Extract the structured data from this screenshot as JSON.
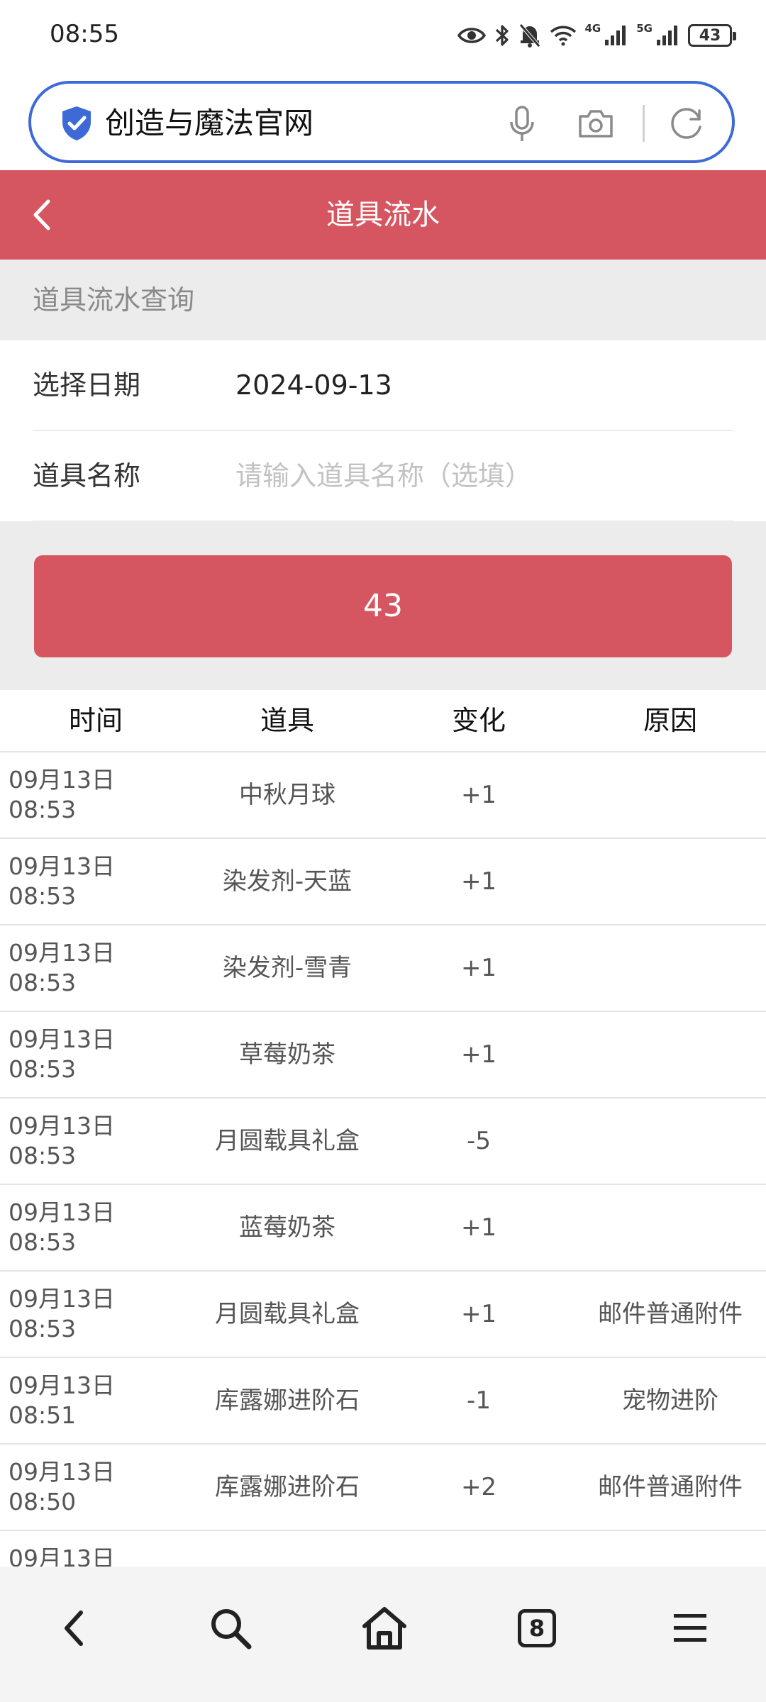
{
  "status_bar": {
    "time": "08:55",
    "net1": "4G",
    "net2": "5G",
    "battery": "43"
  },
  "address_bar": {
    "title": "创造与魔法官网"
  },
  "header": {
    "title": "道具流水"
  },
  "query": {
    "section_title": "道具流水查询",
    "date_label": "选择日期",
    "date_value": "2024-09-13",
    "item_label": "道具名称",
    "item_placeholder": "请输入道具名称（选填）",
    "button_label": "43"
  },
  "table": {
    "headers": [
      "时间",
      "道具",
      "变化",
      "原因"
    ],
    "rows": [
      {
        "date": "09月13日",
        "time": "08:53",
        "item": "中秋月球",
        "change": "+1",
        "reason": ""
      },
      {
        "date": "09月13日",
        "time": "08:53",
        "item": "染发剂-天蓝",
        "change": "+1",
        "reason": ""
      },
      {
        "date": "09月13日",
        "time": "08:53",
        "item": "染发剂-雪青",
        "change": "+1",
        "reason": ""
      },
      {
        "date": "09月13日",
        "time": "08:53",
        "item": "草莓奶茶",
        "change": "+1",
        "reason": ""
      },
      {
        "date": "09月13日",
        "time": "08:53",
        "item": "月圆载具礼盒",
        "change": "-5",
        "reason": ""
      },
      {
        "date": "09月13日",
        "time": "08:53",
        "item": "蓝莓奶茶",
        "change": "+1",
        "reason": ""
      },
      {
        "date": "09月13日",
        "time": "08:53",
        "item": "月圆载具礼盒",
        "change": "+1",
        "reason": "邮件普通附件"
      },
      {
        "date": "09月13日",
        "time": "08:51",
        "item": "库露娜进阶石",
        "change": "-1",
        "reason": "宠物进阶"
      },
      {
        "date": "09月13日",
        "time": "08:50",
        "item": "库露娜进阶石",
        "change": "+2",
        "reason": "邮件普通附件"
      },
      {
        "date": "09月13日",
        "time": "",
        "item": "",
        "change": "",
        "reason": ""
      }
    ]
  },
  "bottom_nav": {
    "tabs_count": "8",
    "icons": [
      "back-icon",
      "search-icon",
      "home-icon",
      "tabs-icon",
      "menu-icon"
    ]
  },
  "colors": {
    "accent": "#d55660",
    "address_border": "#3e6ad8",
    "section_bg": "#ececec"
  }
}
